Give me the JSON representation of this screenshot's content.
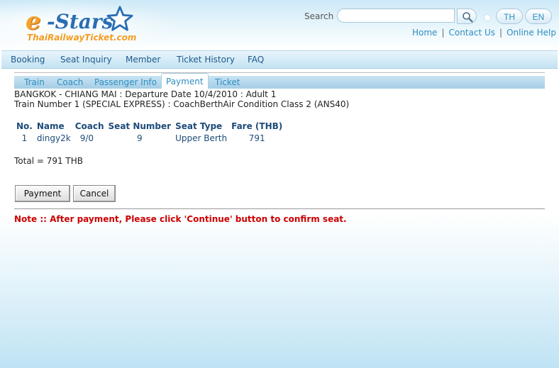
{
  "header": {
    "logo": {
      "text_e": "e",
      "text_stars": "-Stars",
      "subtitle": "ThaiRailwayTicket.com"
    },
    "search": {
      "label": "Search",
      "value": "",
      "placeholder": ""
    },
    "lang": [
      "TH",
      "EN"
    ],
    "links": [
      "Home",
      "Contact Us",
      "Online Help"
    ]
  },
  "nav": {
    "items": [
      "Booking",
      "Seat Inquiry",
      "Member",
      "Ticket History",
      "FAQ"
    ]
  },
  "steps": {
    "items": [
      "Train",
      "Coach",
      "Passenger Info",
      "Payment",
      "Ticket"
    ],
    "active": "Payment"
  },
  "trip": {
    "line1": "BANGKOK - CHIANG MAI : Departure Date 10/4/2010 : Adult 1",
    "line2": "Train Number 1 (SPECIAL EXPRESS) : CoachBerthAir Condition Class 2 (ANS40)"
  },
  "table": {
    "headers": [
      "No.",
      "Name",
      "Coach",
      "Seat Number",
      "Seat Type",
      "Fare (THB)"
    ],
    "rows": [
      [
        "1",
        "dingy2k",
        "9/0",
        "9",
        "Upper Berth",
        "791"
      ]
    ]
  },
  "total": "Total = 791 THB",
  "buttons": {
    "payment": "Payment",
    "cancel": "Cancel"
  },
  "note": "Note :: After payment, Please click 'Continue' button to confirm seat.",
  "colors": {
    "link": "#2f8ec0",
    "nav_text": "#1d5a8e",
    "table_text": "#1d4b7a",
    "note": "#cc0000",
    "logo_orange": "#f5a12a",
    "logo_blue": "#2a6db3"
  },
  "icons": {
    "search_button": "magnifier-icon",
    "logo_star": "star-icon"
  }
}
